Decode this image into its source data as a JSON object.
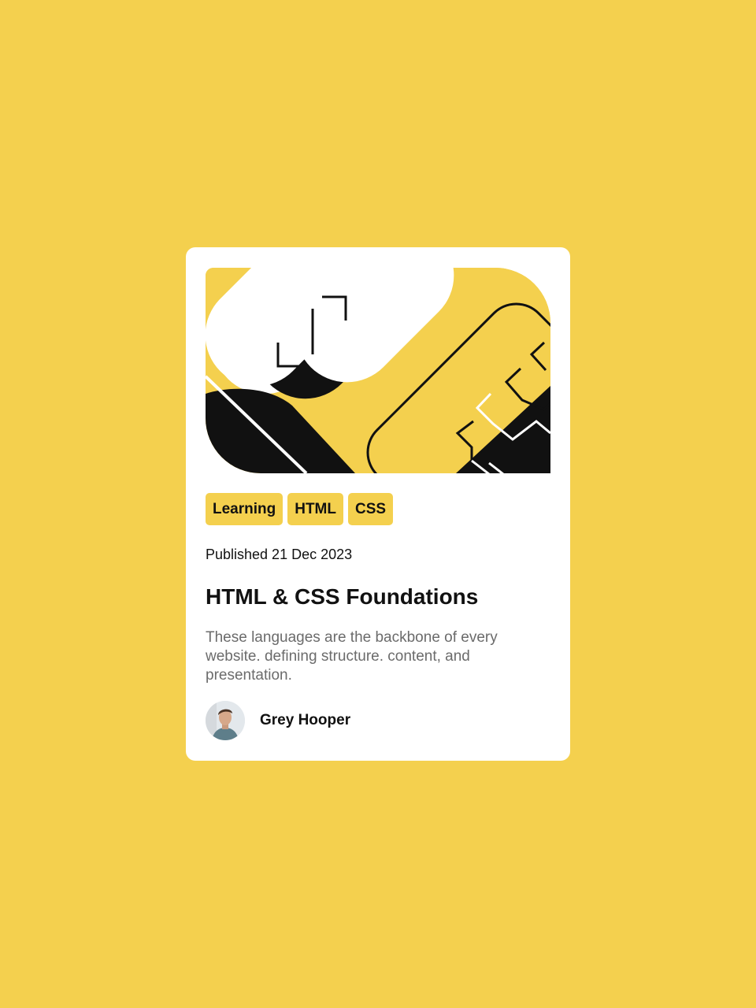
{
  "colors": {
    "background": "#F4D04E",
    "card": "#FFFFFF",
    "text_dark": "#111111",
    "text_muted": "#6B6B6B"
  },
  "card": {
    "illustration": "abstract-yellow-black-illustration",
    "tags": [
      "Learning",
      "HTML",
      "CSS"
    ],
    "published": "Published 21 Dec 2023",
    "title": "HTML & CSS Foundations",
    "description": "These languages are the backbone of every website. defining structure. content, and presentation.",
    "author": {
      "name": "Grey Hooper",
      "avatar_icon": "author-avatar"
    }
  }
}
